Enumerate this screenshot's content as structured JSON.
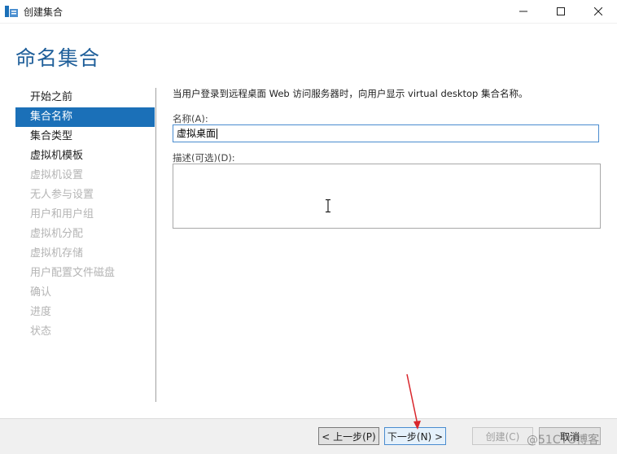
{
  "window": {
    "title": "创建集合",
    "icons": {
      "app": "server-manager-icon",
      "minimize": "minimize-icon",
      "maximize": "maximize-icon",
      "close": "close-icon"
    }
  },
  "page": {
    "heading": "命名集合"
  },
  "nav": {
    "items": [
      {
        "label": "开始之前",
        "state": "normal"
      },
      {
        "label": "集合名称",
        "state": "active"
      },
      {
        "label": "集合类型",
        "state": "normal"
      },
      {
        "label": "虚拟机模板",
        "state": "normal"
      },
      {
        "label": "虚拟机设置",
        "state": "disabled"
      },
      {
        "label": "无人参与设置",
        "state": "disabled"
      },
      {
        "label": "用户和用户组",
        "state": "disabled"
      },
      {
        "label": "虚拟机分配",
        "state": "disabled"
      },
      {
        "label": "虚拟机存储",
        "state": "disabled"
      },
      {
        "label": "用户配置文件磁盘",
        "state": "disabled"
      },
      {
        "label": "确认",
        "state": "disabled"
      },
      {
        "label": "进度",
        "state": "disabled"
      },
      {
        "label": "状态",
        "state": "disabled"
      }
    ]
  },
  "form": {
    "description": "当用户登录到远程桌面 Web 访问服务器时，向用户显示 virtual desktop 集合名称。",
    "name_label": "名称(A):",
    "name_value": "虚拟桌面",
    "desc_label": "描述(可选)(D):",
    "desc_value": ""
  },
  "footer": {
    "prev_label": "< 上一步(P)",
    "next_label": "下一步(N) >",
    "create_label": "创建(C)",
    "cancel_label": "取消"
  },
  "watermark": "@51CTO博客",
  "colors": {
    "accent": "#1b70b8",
    "heading": "#1f5f9a",
    "annotation_arrow": "#d9262c"
  }
}
